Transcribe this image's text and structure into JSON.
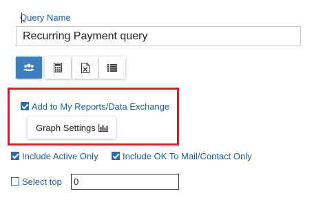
{
  "query_name": {
    "label": "Query Name",
    "value": "Recurring Payment query"
  },
  "toolbar": {
    "buttons": [
      {
        "icon": "users-icon",
        "active": true
      },
      {
        "icon": "calculator-icon",
        "active": false
      },
      {
        "icon": "excel-icon",
        "active": false
      },
      {
        "icon": "list-icon",
        "active": false
      }
    ]
  },
  "highlight_section": {
    "add_to_reports": {
      "label": "Add to My Reports/Data Exchange",
      "checked": true
    },
    "graph_settings": {
      "label": "Graph Settings",
      "icon": "bar-chart-icon"
    }
  },
  "filters": {
    "include_active_only": {
      "label": "Include Active Only",
      "checked": true
    },
    "include_ok_to_mail": {
      "label": "Include OK To Mail/Contact Only",
      "checked": true
    },
    "select_top": {
      "label": "Select top",
      "checked": false,
      "value": "0"
    }
  },
  "colors": {
    "accent": "#3d7ebf",
    "label_blue": "#1a5f9a",
    "highlight_red": "#d0202a"
  }
}
